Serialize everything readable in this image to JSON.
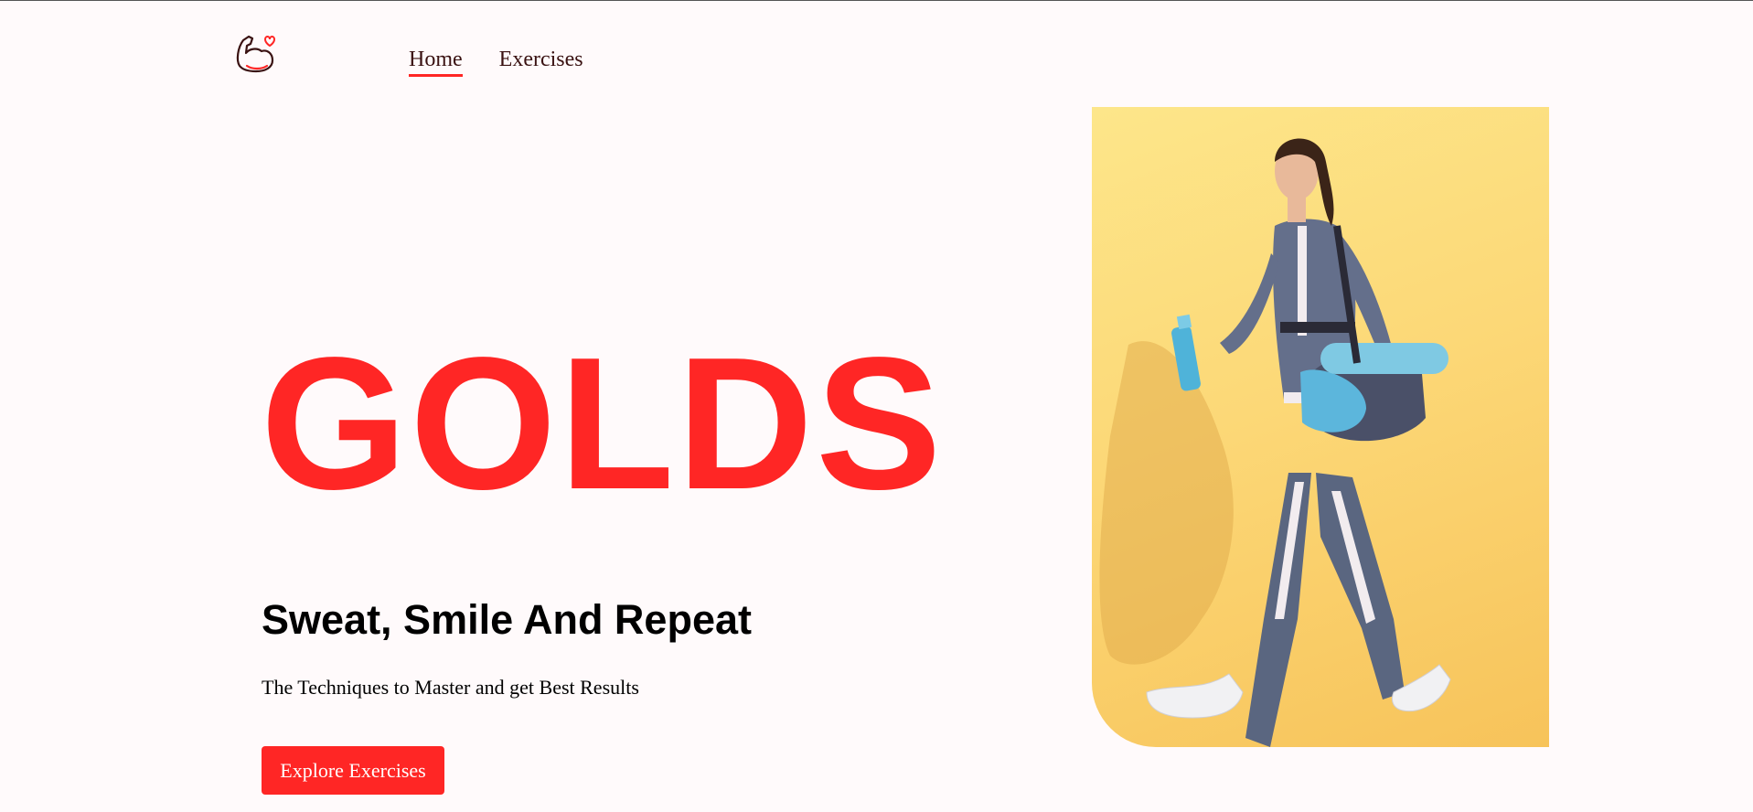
{
  "nav": {
    "logo_icon": "flexed-arm-heart-icon",
    "items": [
      {
        "label": "Home",
        "active": true
      },
      {
        "label": "Exercises",
        "active": false
      }
    ],
    "accent_color": "#ff2625"
  },
  "hero": {
    "title": "GOLDS",
    "subtitle": "Sweat, Smile And Repeat",
    "tagline": "The Techniques to Master and get Best Results",
    "cta_label": "Explore Exercises",
    "banner_image": "woman-walking-with-gym-bag-and-water-bottle"
  }
}
